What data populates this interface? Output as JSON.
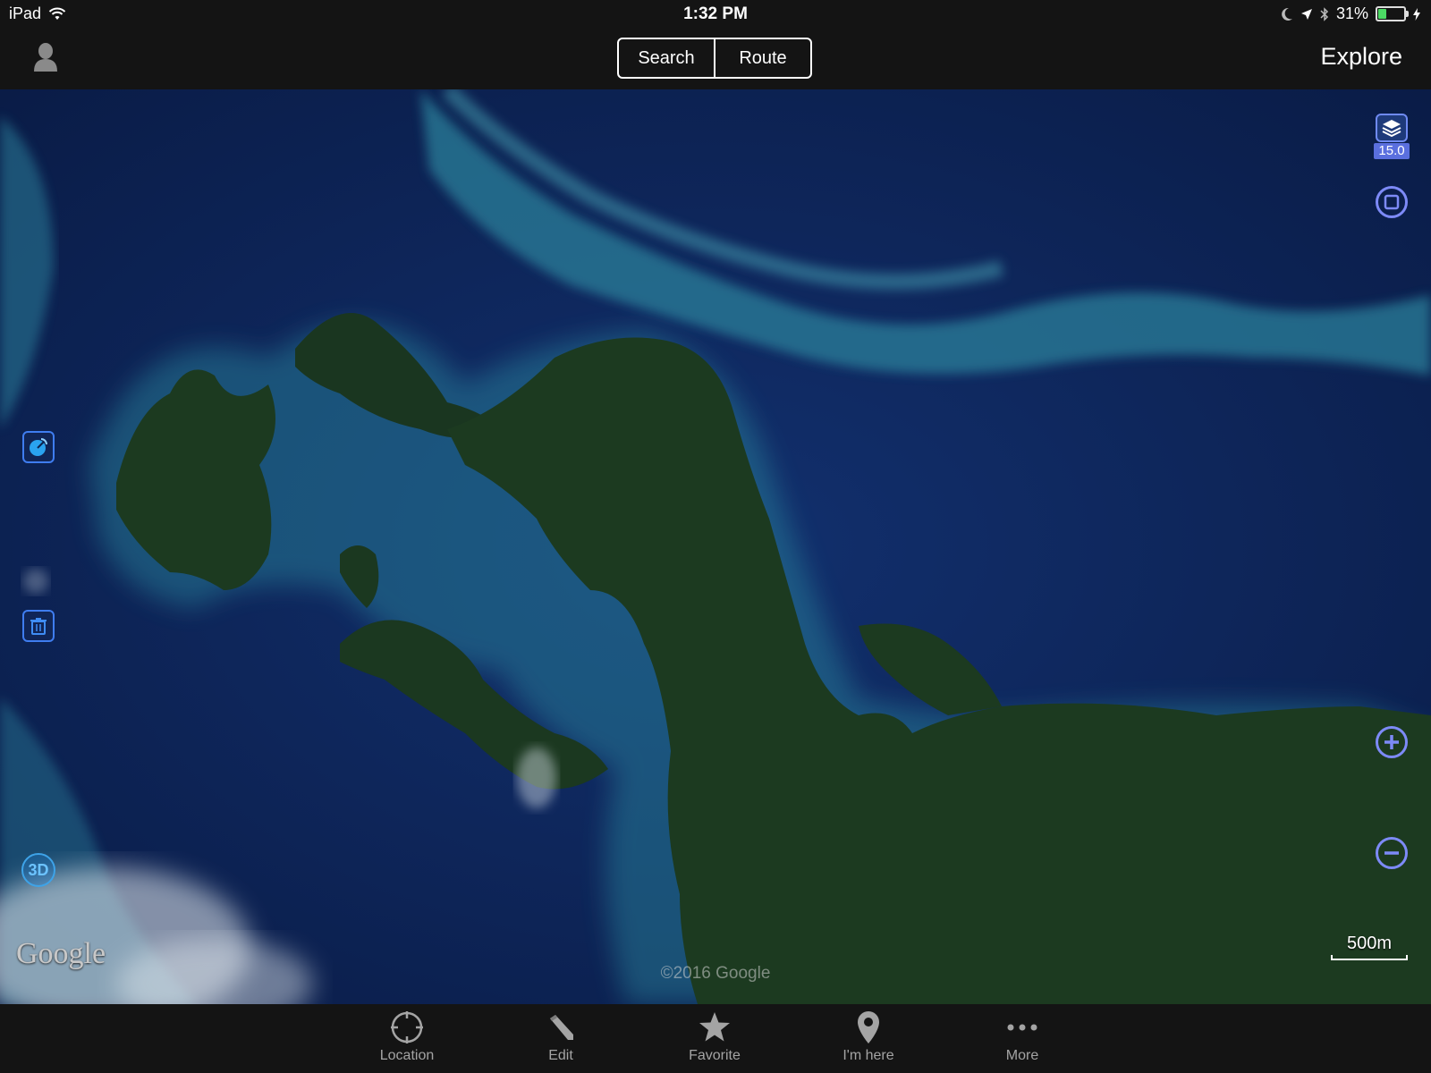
{
  "status_bar": {
    "device": "iPad",
    "time": "1:32 PM",
    "battery": "31%"
  },
  "nav_bar": {
    "segments": [
      "Search",
      "Route"
    ],
    "right_title": "Explore"
  },
  "map": {
    "zoom_level": "15.0",
    "provider_logo": "Google",
    "copyright": "©2016 Google",
    "scale_label": "500m",
    "mode_3d_label": "3D"
  },
  "tab_bar": {
    "items": [
      {
        "label": "Location",
        "icon": "crosshair-icon"
      },
      {
        "label": "Edit",
        "icon": "pencil-icon"
      },
      {
        "label": "Favorite",
        "icon": "star-icon"
      },
      {
        "label": "I'm here",
        "icon": "pin-icon"
      },
      {
        "label": "More",
        "icon": "ellipsis-icon"
      }
    ]
  },
  "colors": {
    "ocean": "#0d2356",
    "land": "#1c3a20",
    "reef": "#2a7f9a",
    "control_accent": "#7d8af7"
  }
}
